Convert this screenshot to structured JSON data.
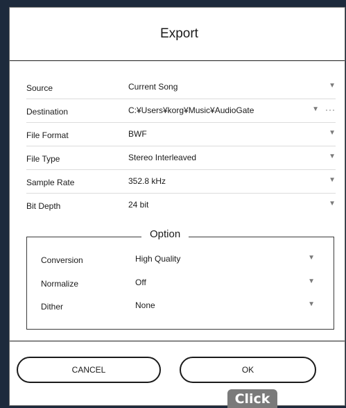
{
  "dialog": {
    "title": "Export"
  },
  "fields": [
    {
      "label": "Source",
      "value": "Current Song"
    },
    {
      "label": "Destination",
      "value": "C:¥Users¥korg¥Music¥AudioGate",
      "more": "···"
    },
    {
      "label": "File Format",
      "value": "BWF"
    },
    {
      "label": "File Type",
      "value": "Stereo Interleaved"
    },
    {
      "label": "Sample Rate",
      "value": "352.8 kHz"
    },
    {
      "label": "Bit Depth",
      "value": "24 bit"
    }
  ],
  "option": {
    "title": "Option",
    "fields": [
      {
        "label": "Conversion",
        "value": "High Quality"
      },
      {
        "label": "Normalize",
        "value": "Off"
      },
      {
        "label": "Dither",
        "value": "None"
      }
    ]
  },
  "buttons": {
    "cancel": "CANCEL",
    "ok": "OK"
  },
  "overlay": {
    "click_label": "Click"
  },
  "icons": {
    "dropdown": "chevron-down-icon",
    "more": "more-icon"
  }
}
